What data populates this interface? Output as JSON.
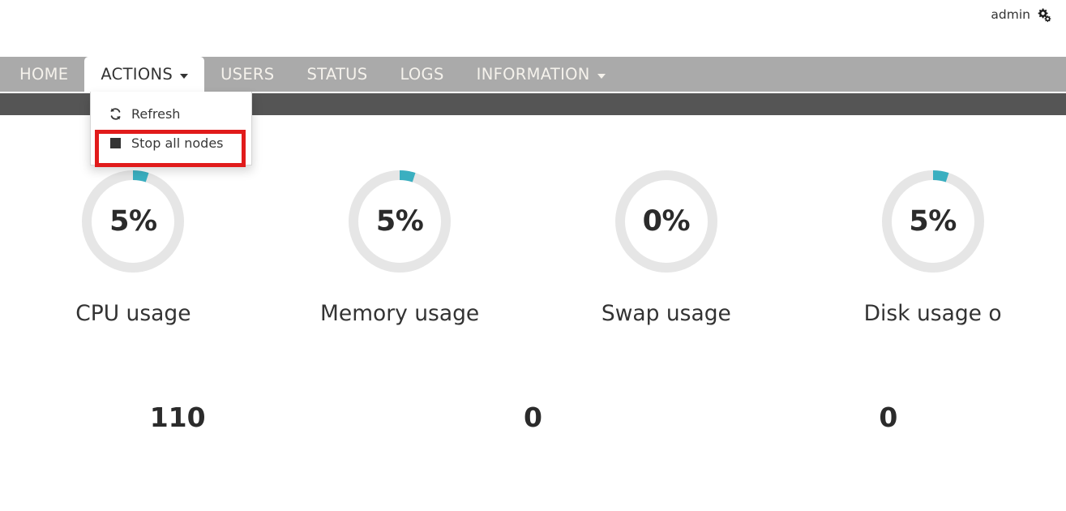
{
  "header": {
    "user_label": "admin",
    "settings_icon": "cogs-icon"
  },
  "nav": {
    "items": [
      {
        "label": "HOME",
        "active": false,
        "has_caret": false
      },
      {
        "label": "ACTIONS",
        "active": true,
        "has_caret": true
      },
      {
        "label": "USERS",
        "active": false,
        "has_caret": false
      },
      {
        "label": "STATUS",
        "active": false,
        "has_caret": false
      },
      {
        "label": "LOGS",
        "active": false,
        "has_caret": false
      },
      {
        "label": "INFORMATION",
        "active": false,
        "has_caret": true
      }
    ]
  },
  "dropdown": {
    "open_for": "ACTIONS",
    "items": [
      {
        "label": "Refresh",
        "icon": "refresh-icon",
        "highlighted": false
      },
      {
        "label": "Stop all nodes",
        "icon": "stop-square-icon",
        "highlighted": true
      }
    ],
    "highlight_color": "#e11b1b"
  },
  "gauges": [
    {
      "value_text": "5%",
      "percent": 5,
      "label": "CPU usage"
    },
    {
      "value_text": "5%",
      "percent": 5,
      "label": "Memory usage"
    },
    {
      "value_text": "0%",
      "percent": 0,
      "label": "Swap usage"
    },
    {
      "value_text": "5%",
      "percent": 5,
      "label": "Disk usage o"
    }
  ],
  "gauge_colors": {
    "track": "#e6e6e6",
    "progress": "#3aafc0"
  },
  "stats": [
    {
      "value": "110"
    },
    {
      "value": "0"
    },
    {
      "value": "0"
    }
  ]
}
